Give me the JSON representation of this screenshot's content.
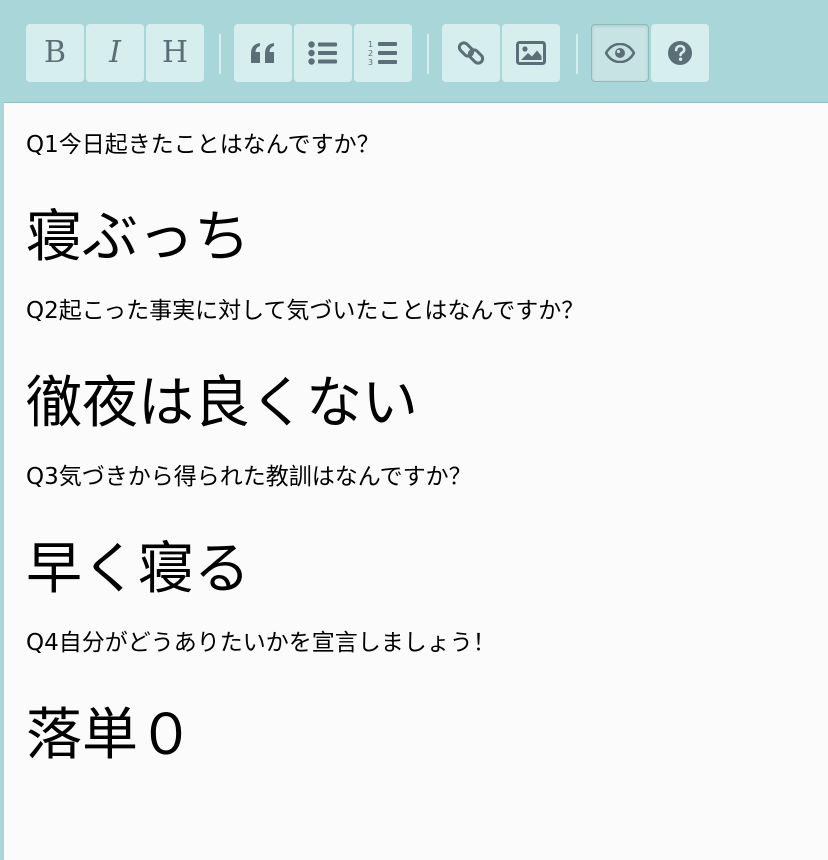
{
  "toolbar": {
    "bold_label": "B",
    "italic_label": "I",
    "heading_label": "H",
    "icons": [
      "quote-icon",
      "unordered-list-icon",
      "ordered-list-icon",
      "link-icon",
      "image-icon",
      "preview-eye-icon",
      "help-icon"
    ],
    "colors": {
      "toolbar_bg": "#a9d6d8",
      "button_bg": "#d7eeee",
      "icon": "#5a6f78",
      "editor_bg": "#fbfbfb"
    }
  },
  "editor": {
    "q1": "Q1今日起きたことはなんですか？",
    "a1": "寝ぶっち",
    "q2": "Q2起こった事実に対して気づいたことはなんですか？",
    "a2": "徹夜は良くない",
    "q3": "Q3気づきから得られた教訓はなんですか？",
    "a3": "早く寝る",
    "q4": "Q4自分がどうありたいかを宣言しましょう！",
    "a4": "落単０"
  }
}
